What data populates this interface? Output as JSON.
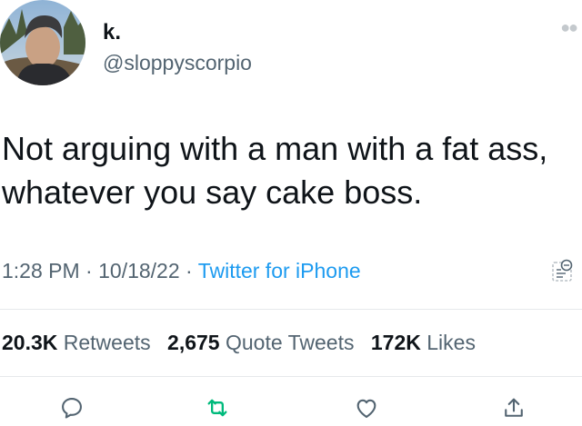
{
  "tweet": {
    "display_name": "k.",
    "handle": "@sloppyscorpio",
    "text_line1": "Not arguing with a man with a fat ass,",
    "text_line2": "whatever you say cake boss.",
    "time": "1:28 PM",
    "date": "10/18/22",
    "separator": "·",
    "source": "Twitter for iPhone"
  },
  "stats": {
    "retweets_count": "20.3K",
    "retweets_label": "Retweets",
    "quotes_count": "2,675",
    "quotes_label": "Quote Tweets",
    "likes_count": "172K",
    "likes_label": "Likes"
  },
  "icons": {
    "more": "more-icon",
    "analytics": "analytics-icon",
    "reply": "reply-icon",
    "retweet": "retweet-icon",
    "like": "heart-icon",
    "share": "share-icon"
  },
  "colors": {
    "link": "#1d9bf0",
    "secondary_text": "#536471",
    "retweet_icon": "#00ba7c",
    "primary_text": "#0f1419"
  }
}
